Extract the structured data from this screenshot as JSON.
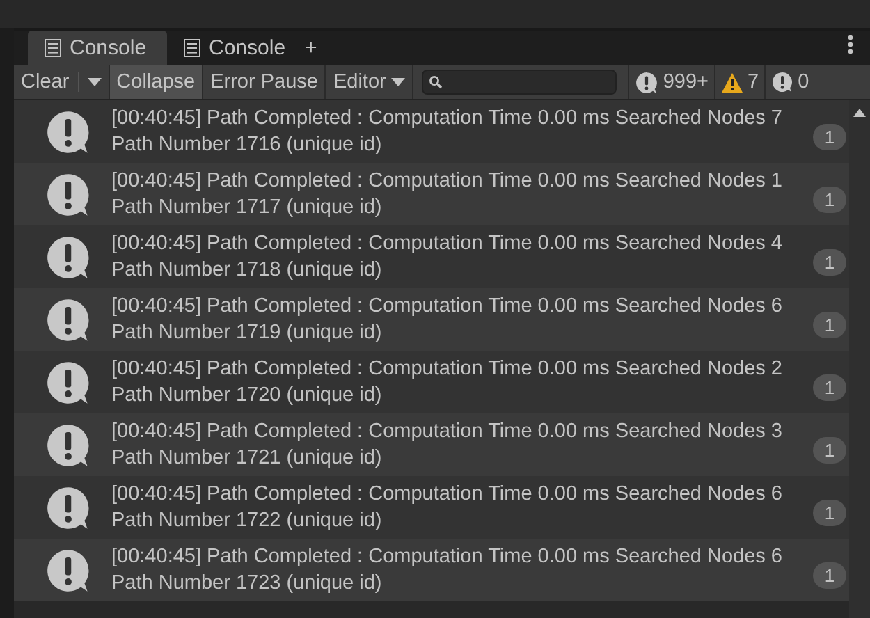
{
  "tabs": [
    {
      "label": "Console",
      "selected": true
    },
    {
      "label": "Console",
      "selected": false
    }
  ],
  "add_tab": "+",
  "toolbar": {
    "clear": "Clear",
    "toggles": [
      {
        "label": "Collapse",
        "on": true
      },
      {
        "label": "Error Pause",
        "on": false
      }
    ],
    "editor": "Editor",
    "counters": [
      {
        "kind": "info",
        "count": "999+"
      },
      {
        "kind": "warning",
        "count": "7"
      },
      {
        "kind": "error",
        "count": "0"
      }
    ]
  },
  "messages": [
    {
      "line1": "[00:40:45] Path Completed : Computation Time 0.00 ms Searched Nodes 7",
      "line2": "Path Number 1716 (unique id)",
      "count": "1"
    },
    {
      "line1": "[00:40:45] Path Completed : Computation Time 0.00 ms Searched Nodes 1",
      "line2": "Path Number 1717 (unique id)",
      "count": "1"
    },
    {
      "line1": "[00:40:45] Path Completed : Computation Time 0.00 ms Searched Nodes 4",
      "line2": "Path Number 1718 (unique id)",
      "count": "1"
    },
    {
      "line1": "[00:40:45] Path Completed : Computation Time 0.00 ms Searched Nodes 6",
      "line2": "Path Number 1719 (unique id)",
      "count": "1"
    },
    {
      "line1": "[00:40:45] Path Completed : Computation Time 0.00 ms Searched Nodes 2",
      "line2": "Path Number 1720 (unique id)",
      "count": "1"
    },
    {
      "line1": "[00:40:45] Path Completed : Computation Time 0.00 ms Searched Nodes 3",
      "line2": "Path Number 1721 (unique id)",
      "count": "1"
    },
    {
      "line1": "[00:40:45] Path Completed : Computation Time 0.00 ms Searched Nodes 6",
      "line2": "Path Number 1722 (unique id)",
      "count": "1"
    },
    {
      "line1": "[00:40:45] Path Completed : Computation Time 0.00 ms Searched Nodes 6",
      "line2": "Path Number 1723 (unique id)",
      "count": "1"
    }
  ]
}
